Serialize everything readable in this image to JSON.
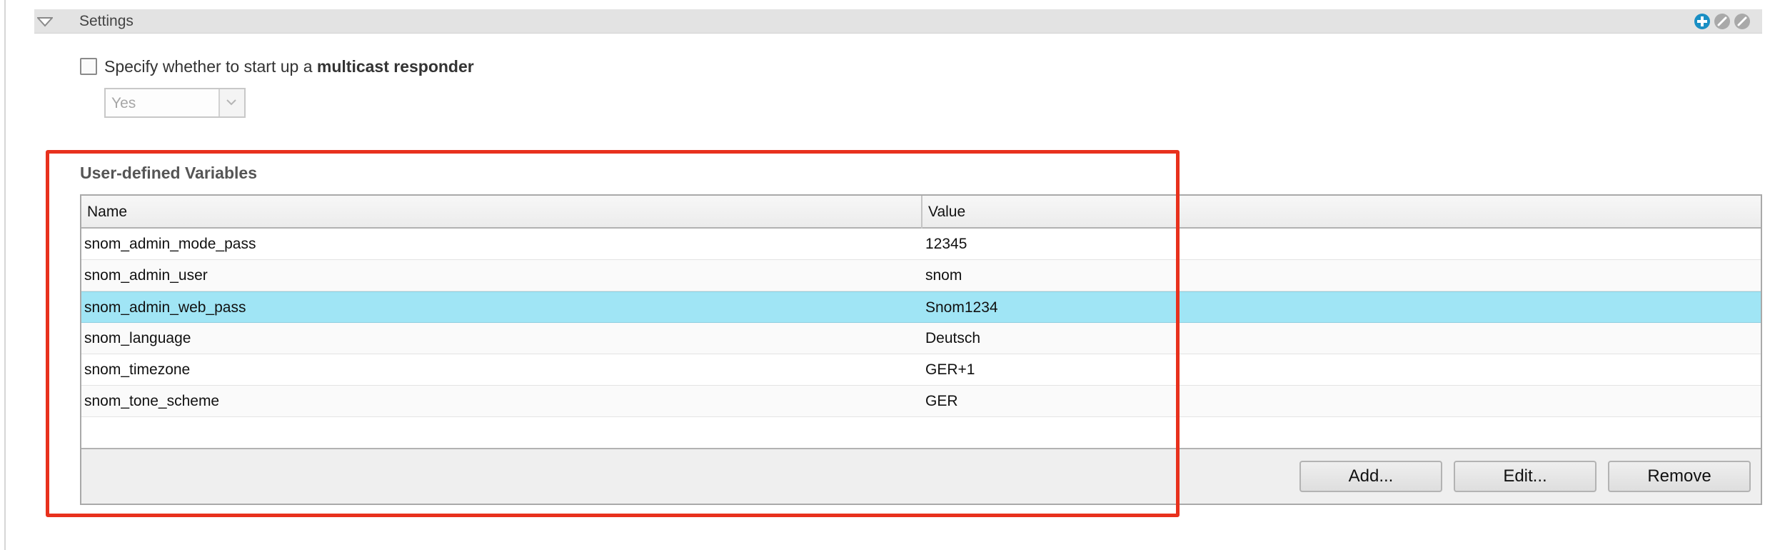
{
  "settings": {
    "title": "Settings",
    "header_icons": [
      "add-circle-icon",
      "edit-icon",
      "edit-icon"
    ],
    "accent_color": "#1a8fc4"
  },
  "multicast": {
    "label_prefix": "Specify whether to start up a ",
    "label_bold": "multicast responder",
    "checked": false,
    "select_value": "Yes"
  },
  "variables": {
    "title": "User-defined Variables",
    "columns": [
      "Name",
      "Value"
    ],
    "rows": [
      {
        "name": "snom_admin_mode_pass",
        "value": "12345",
        "selected": false
      },
      {
        "name": "snom_admin_user",
        "value": "snom",
        "selected": false
      },
      {
        "name": "snom_admin_web_pass",
        "value": "Snom1234",
        "selected": true
      },
      {
        "name": "snom_language",
        "value": "Deutsch",
        "selected": false
      },
      {
        "name": "snom_timezone",
        "value": "GER+1",
        "selected": false
      },
      {
        "name": "snom_tone_scheme",
        "value": "GER",
        "selected": false
      }
    ],
    "buttons": {
      "add": "Add...",
      "edit": "Edit...",
      "remove": "Remove"
    },
    "selected_color": "#a0e5f5"
  },
  "highlight_color": "#e8311d"
}
